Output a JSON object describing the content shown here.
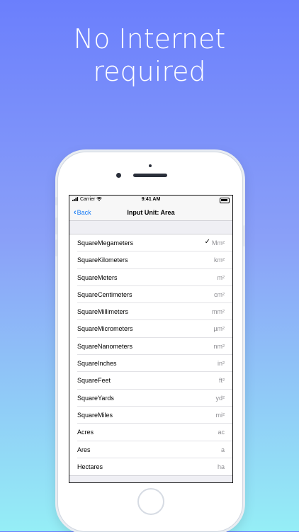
{
  "headline": [
    "No Internet",
    "required"
  ],
  "status_bar": {
    "carrier": "Carrier",
    "time": "9:41 AM"
  },
  "nav": {
    "back_label": "Back",
    "title": "Input Unit: Area"
  },
  "units": [
    {
      "name": "SquareMegameters",
      "symbol": "Mm²",
      "selected": true
    },
    {
      "name": "SquareKilometers",
      "symbol": "km²"
    },
    {
      "name": "SquareMeters",
      "symbol": "m²"
    },
    {
      "name": "SquareCentimeters",
      "symbol": "cm²"
    },
    {
      "name": "SquareMillimeters",
      "symbol": "mm²"
    },
    {
      "name": "SquareMicrometers",
      "symbol": "µm²"
    },
    {
      "name": "SquareNanometers",
      "symbol": "nm²"
    },
    {
      "name": "SquareInches",
      "symbol": "in²"
    },
    {
      "name": "SquareFeet",
      "symbol": "ft²"
    },
    {
      "name": "SquareYards",
      "symbol": "yd²"
    },
    {
      "name": "SquareMiles",
      "symbol": "mi²"
    },
    {
      "name": "Acres",
      "symbol": "ac"
    },
    {
      "name": "Ares",
      "symbol": "a"
    },
    {
      "name": "Hectares",
      "symbol": "ha"
    }
  ],
  "selected_mark": "✓",
  "colors": {
    "accent": "#1a7cf5",
    "bg_top": "#6b7ffc",
    "bg_bottom": "#95eef6"
  }
}
